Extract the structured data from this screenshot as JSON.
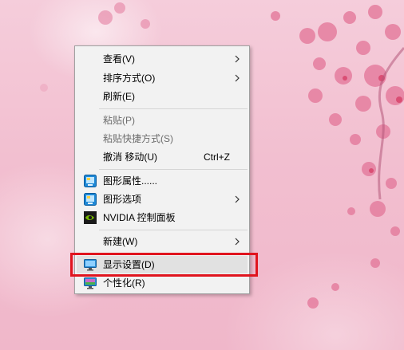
{
  "desktop": {
    "wallpaper": "pink-cherry-blossom",
    "accent_colors": [
      "#f5cddb",
      "#e87fa0",
      "#d9486f"
    ]
  },
  "context_menu": {
    "items": [
      {
        "label": "查看(V)",
        "has_submenu": true,
        "icon": null
      },
      {
        "label": "排序方式(O)",
        "has_submenu": true,
        "icon": null
      },
      {
        "label": "刷新(E)",
        "has_submenu": false,
        "icon": null
      },
      {
        "label": "粘贴(P)",
        "disabled": true,
        "icon": null
      },
      {
        "label": "粘贴快捷方式(S)",
        "disabled": true,
        "icon": null
      },
      {
        "label": "撤消 移动(U)",
        "shortcut": "Ctrl+Z",
        "icon": null
      },
      {
        "label": "图形属性......",
        "icon": "intel-graphics-icon"
      },
      {
        "label": "图形选项",
        "has_submenu": true,
        "icon": "intel-graphics-icon"
      },
      {
        "label": "NVIDIA 控制面板",
        "icon": "nvidia-icon"
      },
      {
        "label": "新建(W)",
        "has_submenu": true,
        "icon": null
      },
      {
        "label": "显示设置(D)",
        "icon": "display-monitor-icon",
        "highlighted": true
      },
      {
        "label": "个性化(R)",
        "icon": "personalize-monitor-icon"
      }
    ]
  },
  "annotation": {
    "highlight_color": "#e0141e",
    "target": "显示设置(D)"
  }
}
